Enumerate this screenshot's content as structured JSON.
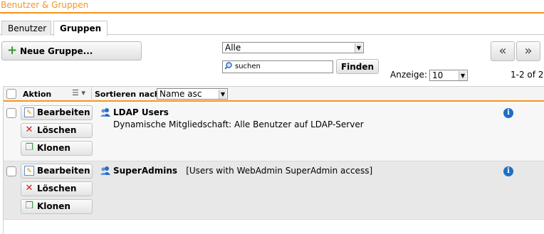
{
  "window": {
    "title": "Benutzer & Gruppen"
  },
  "tabs": [
    {
      "label": "Benutzer"
    },
    {
      "label": "Gruppen"
    }
  ],
  "toolbar": {
    "new_group_label": "Neue Gruppe..."
  },
  "filter": {
    "selected": "Alle",
    "search_placeholder": "suchen",
    "search_button": "Finden",
    "display_label": "Anzeige:",
    "display_value": "10",
    "pager_count": "1-2 of 2",
    "prev_label": "«",
    "next_label": "»"
  },
  "list": {
    "header": {
      "action_label": "Aktion",
      "sort_label": "Sortieren nach:",
      "sort_value": "Name asc"
    },
    "actions": {
      "edit": "Bearbeiten",
      "delete": "Löschen",
      "clone": "Klonen"
    },
    "rows": [
      {
        "name": "LDAP Users",
        "comment": "",
        "description": "Dynamische Mitgliedschaft: Alle Benutzer auf LDAP-Server"
      },
      {
        "name": "SuperAdmins",
        "comment": "[Users with WebAdmin SuperAdmin access]",
        "description": ""
      }
    ]
  },
  "colors": {
    "accent": "#f7941d",
    "info": "#1f6fc2"
  }
}
